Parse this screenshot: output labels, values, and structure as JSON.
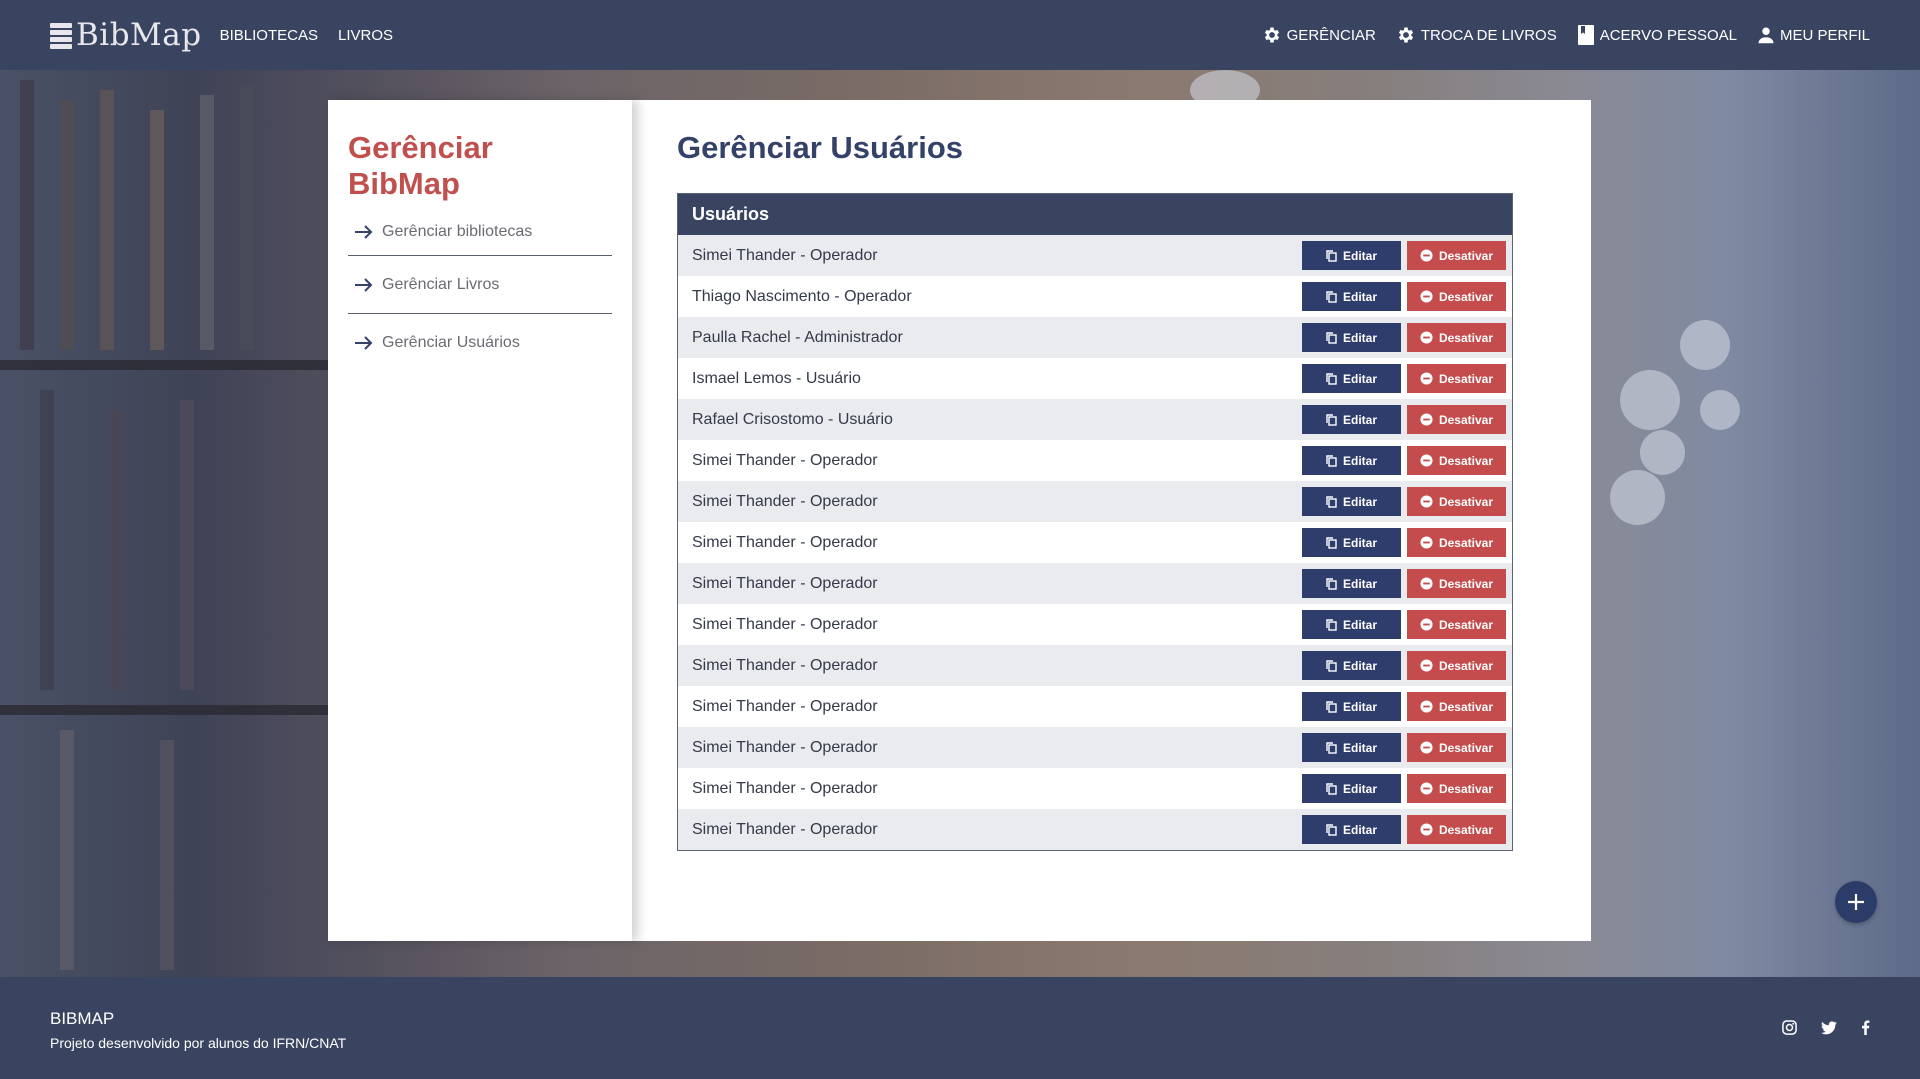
{
  "header": {
    "logo_text": "BibMap",
    "nav_left": [
      "BIBLIOTECAS",
      "LIVROS"
    ],
    "nav_right": [
      {
        "label": "GERÊNCIAR",
        "icon": "gear-icon"
      },
      {
        "label": "TROCA DE LIVROS",
        "icon": "gear-icon"
      },
      {
        "label": "ACERVO PESSOAL",
        "icon": "book-icon"
      },
      {
        "label": "MEU PERFIL",
        "icon": "person-icon"
      }
    ]
  },
  "sidebar": {
    "title": "Gerênciar BibMap",
    "items": [
      "Gerênciar bibliotecas",
      "Gerênciar Livros",
      "Gerênciar Usuários"
    ]
  },
  "main": {
    "title": "Gerênciar Usuários",
    "table_header": "Usuários",
    "edit_label": "Editar",
    "deactivate_label": "Desativar",
    "users": [
      "Simei Thander - Operador",
      "Thiago Nascimento - Operador",
      "Paulla Rachel - Administrador",
      "Ismael Lemos - Usuário",
      "Rafael Crisostomo - Usuário",
      "Simei Thander - Operador",
      "Simei Thander - Operador",
      "Simei Thander - Operador",
      "Simei Thander - Operador",
      "Simei Thander - Operador",
      "Simei Thander - Operador",
      "Simei Thander - Operador",
      "Simei Thander - Operador",
      "Simei Thander - Operador",
      "Simei Thander - Operador"
    ]
  },
  "footer": {
    "brand": "BIBMAP",
    "description": "Projeto desenvolvido por alunos do IFRN/CNAT",
    "socials": [
      "instagram-icon",
      "twitter-icon",
      "facebook-icon"
    ]
  },
  "colors": {
    "navy": "#394560",
    "accent_red": "#c0504d",
    "button_blue": "#2e3d6b",
    "button_red": "#c44c4c"
  }
}
